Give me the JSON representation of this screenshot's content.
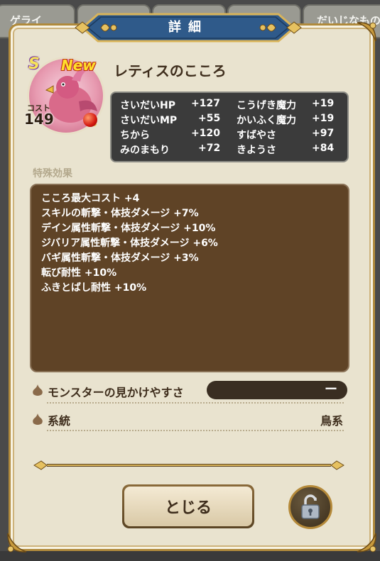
{
  "background_tabs": {
    "left_label": "ゲライ",
    "right_label": "だいじなもの"
  },
  "dialog": {
    "title": "詳細"
  },
  "heart": {
    "rank": "S",
    "new_badge": "New",
    "name": "レティスのこころ",
    "cost_label": "コスト",
    "cost_value": "149"
  },
  "stats": [
    {
      "label": "さいだいHP",
      "value": "+127"
    },
    {
      "label": "こうげき魔力",
      "value": "+19"
    },
    {
      "label": "さいだいMP",
      "value": "+55"
    },
    {
      "label": "かいふく魔力",
      "value": "+19"
    },
    {
      "label": "ちから",
      "value": "+120"
    },
    {
      "label": "すばやさ",
      "value": "+97"
    },
    {
      "label": "みのまもり",
      "value": "+72"
    },
    {
      "label": "きようさ",
      "value": "+84"
    }
  ],
  "special_effects": {
    "label": "特殊効果",
    "items": [
      "こころ最大コスト +4",
      "スキルの斬撃・体技ダメージ +7%",
      "デイン属性斬撃・体技ダメージ +10%",
      "ジバリア属性斬撃・体技ダメージ +6%",
      "バギ属性斬撃・体技ダメージ +3%",
      "転び耐性 +10%",
      "ふきとばし耐性 +10%"
    ]
  },
  "visibility": {
    "label": "モンスターの見かけやすさ",
    "value": "ー"
  },
  "family": {
    "label": "系統",
    "value": "鳥系"
  },
  "buttons": {
    "close_label": "とじる"
  },
  "icons": {
    "row_bullet": "onion-bullet-icon",
    "lock": "unlocked-padlock-icon"
  },
  "colors": {
    "title_plate": "#2f5a8a",
    "panel_bg": "#e9e3cf",
    "effects_bg": "#5f4326",
    "stats_bg": "#3b3b3b",
    "gold_trim": "#b08a3c"
  }
}
